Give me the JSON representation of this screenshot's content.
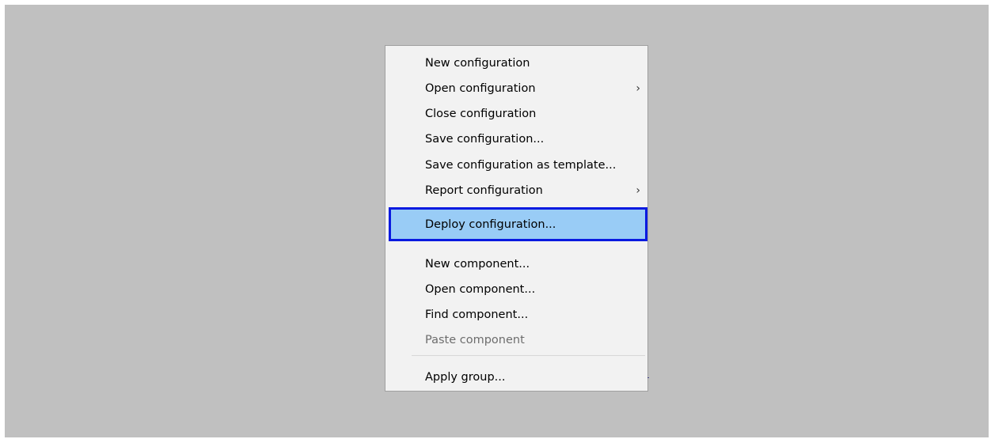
{
  "menu": {
    "items": [
      {
        "label": "New configuration",
        "has_submenu": false,
        "state": "normal"
      },
      {
        "label": "Open configuration",
        "has_submenu": true,
        "state": "normal"
      },
      {
        "label": "Close configuration",
        "has_submenu": false,
        "state": "normal"
      },
      {
        "label": "Save configuration...",
        "has_submenu": false,
        "state": "normal"
      },
      {
        "label": "Save configuration as template...",
        "has_submenu": false,
        "state": "normal"
      },
      {
        "label": "Report configuration",
        "has_submenu": true,
        "state": "normal"
      },
      {
        "label": "Deploy configuration...",
        "has_submenu": false,
        "state": "highlighted"
      },
      {
        "label": "New component...",
        "has_submenu": false,
        "state": "normal"
      },
      {
        "label": "Open component...",
        "has_submenu": false,
        "state": "normal"
      },
      {
        "label": "Find component...",
        "has_submenu": false,
        "state": "normal"
      },
      {
        "label": "Paste component",
        "has_submenu": false,
        "state": "disabled"
      },
      {
        "label": "Apply group...",
        "has_submenu": false,
        "state": "normal"
      }
    ],
    "submenu_arrow": "›"
  },
  "colors": {
    "backdrop": "#c0c0c0",
    "menu_background": "#f2f2f2",
    "highlight_fill": "#99ccf6",
    "highlight_border": "#0a1ae0",
    "disabled_text": "#6d6d6d"
  },
  "icons": {
    "submenu": "chevron-right-icon"
  }
}
